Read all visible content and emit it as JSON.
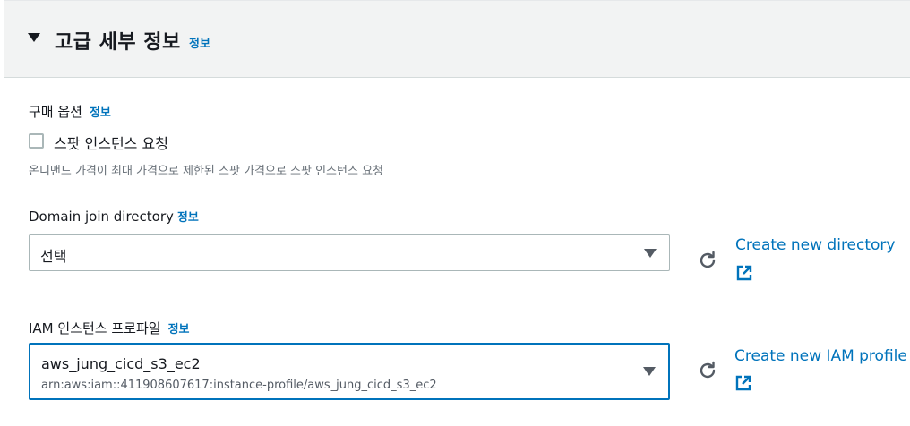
{
  "section": {
    "title": "고급 세부 정보",
    "info": "정보"
  },
  "purchase_option": {
    "label": "구매 옵션",
    "info": "정보",
    "checkbox_label": "스팟 인스턴스 요청",
    "checked": false,
    "hint": "온디맨드 가격이 최대 가격으로 제한된 스팟 가격으로 스팟 인스턴스 요청"
  },
  "domain_join": {
    "label": "Domain join directory",
    "info": "정보",
    "selected": "선택",
    "create_link": "Create new directory"
  },
  "iam_profile": {
    "label": "IAM 인스턴스 프로파일",
    "info": "정보",
    "selected": "aws_jung_cicd_s3_ec2",
    "arn": "arn:aws:iam::411908607617:instance-profile/aws_jung_cicd_s3_ec2",
    "create_link": "Create new IAM profile"
  },
  "colors": {
    "link": "#0073bb",
    "focus_border": "#0073bb",
    "header_bg": "#f2f3f3",
    "text": "#16191f"
  }
}
